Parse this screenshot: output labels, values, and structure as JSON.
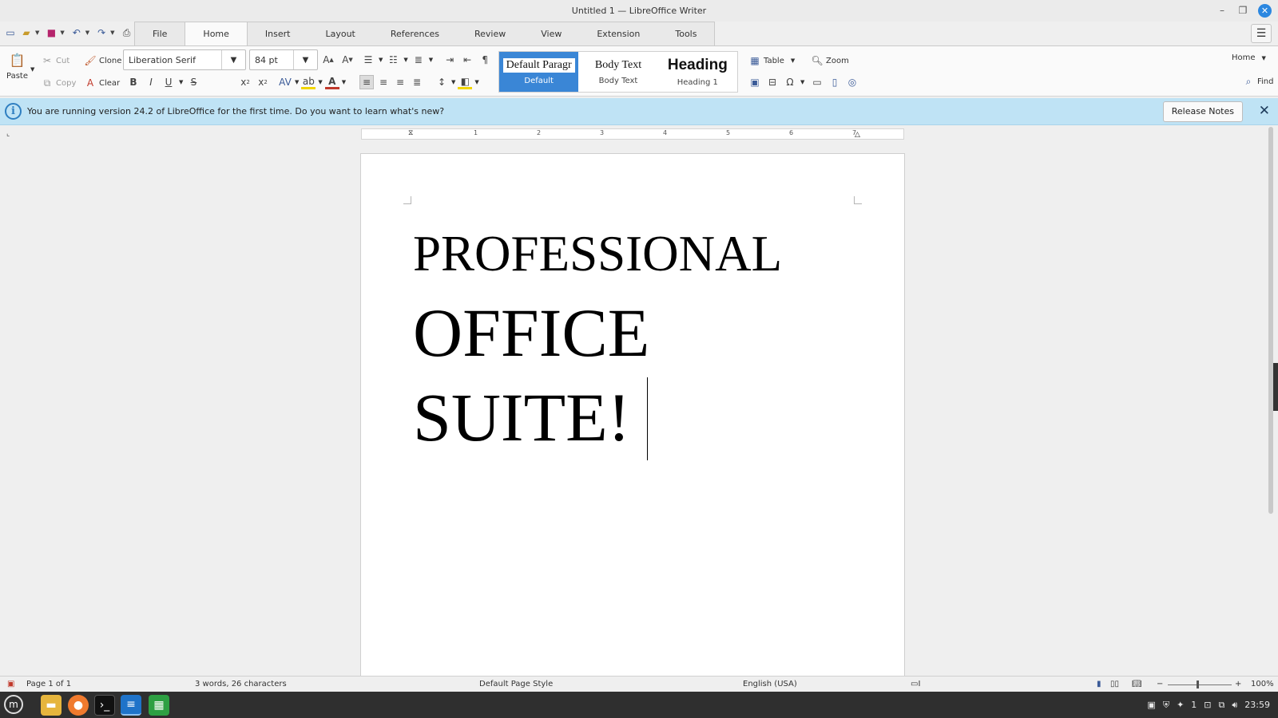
{
  "window": {
    "title": "Untitled 1 — LibreOffice Writer"
  },
  "menu_tabs": [
    "File",
    "Home",
    "Insert",
    "Layout",
    "References",
    "Review",
    "View",
    "Extension",
    "Tools"
  ],
  "ribbon": {
    "paste": "Paste",
    "cut": "Cut",
    "copy": "Copy",
    "clone": "Clone",
    "clear": "Clear",
    "font_name": "Liberation Serif",
    "font_size": "84 pt",
    "styles": {
      "default_preview": "Default Paragr",
      "default_label": "Default",
      "body_preview": "Body Text",
      "body_label": "Body Text",
      "heading_preview": "Heading",
      "heading_label": "Heading 1"
    },
    "table": "Table",
    "zoom": "Zoom",
    "home_dropdown": "Home",
    "find": "Find"
  },
  "infobar": {
    "message": "You are running version 24.2 of LibreOffice for the first time. Do you want to learn what's new?",
    "button": "Release Notes"
  },
  "ruler_numbers": [
    "1",
    "2",
    "3",
    "4",
    "5",
    "6",
    "7"
  ],
  "document": {
    "lines": [
      "PROFESSIONAL",
      "OFFICE",
      "SUITE!"
    ]
  },
  "status": {
    "page": "Page 1 of 1",
    "words": "3 words, 26 characters",
    "page_style": "Default Page Style",
    "language": "English (USA)",
    "zoom": "100%"
  },
  "taskbar": {
    "clock": "23:59",
    "workspace": "1"
  },
  "colors": {
    "accent": "#3a86d6",
    "infobar": "#bfe3f5",
    "taskbar": "#2f2f2f"
  }
}
